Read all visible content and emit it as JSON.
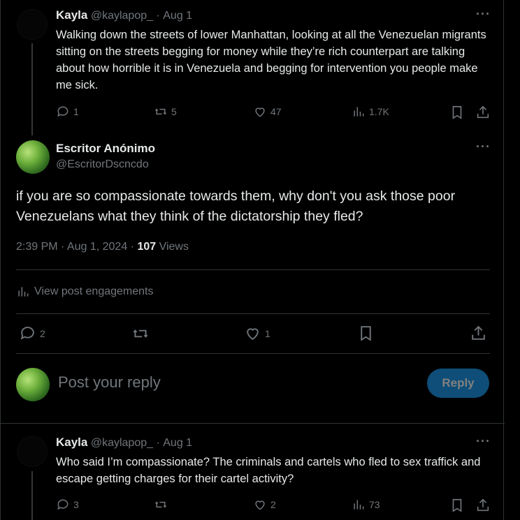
{
  "tweet1": {
    "name": "Kayla",
    "handle": "@kaylapop_",
    "sep": "·",
    "date": "Aug 1",
    "text": "Walking down the streets of lower Manhattan, looking at all the Venezuelan migrants sitting on the streets begging for money while they’re rich counterpart are talking about how horrible it is in Venezuela and begging for intervention you people make me sick.",
    "replies": "1",
    "reposts": "5",
    "likes": "47",
    "views": "1.7K"
  },
  "main": {
    "name": "Escritor Anónimo",
    "handle": "@EscritorDscncdo",
    "text": "if you are so compassionate towards them, why don't you ask those poor Venezuelans what they think of the dictatorship they fled?",
    "time": "2:39 PM · Aug 1, 2024 · ",
    "views_count": "107",
    "views_label": " Views",
    "engagements": "View post engagements",
    "replies": "2",
    "likes": "1"
  },
  "composer": {
    "placeholder": "Post your reply",
    "button": "Reply"
  },
  "tweet2": {
    "name": "Kayla",
    "handle": "@kaylapop_",
    "sep": "·",
    "date": "Aug 1",
    "text": "Who said I’m compassionate? The criminals and cartels who fled to sex traffick and escape getting charges for their cartel activity?",
    "replies": "3",
    "likes": "2",
    "views": "73"
  },
  "more_label": "···"
}
